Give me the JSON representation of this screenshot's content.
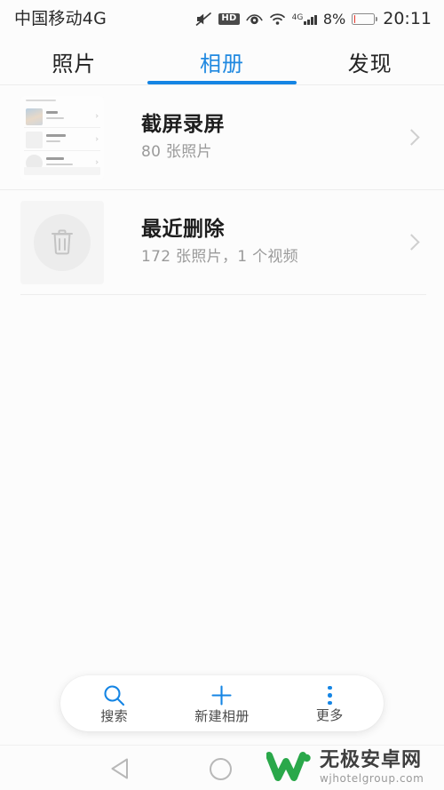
{
  "statusbar": {
    "carrier": "中国移动4G",
    "hd_label": "HD",
    "network_type": "4G",
    "battery_percent": "8%",
    "battery_level": 8,
    "clock": "20:11",
    "icons": [
      "mute-icon",
      "hd-icon",
      "eye-comfort-icon",
      "wifi-icon",
      "signal-bars-icon",
      "battery-icon"
    ],
    "battery_color": "#e8352a"
  },
  "tabs": {
    "items": [
      {
        "label": "照片",
        "active": false
      },
      {
        "label": "相册",
        "active": true
      },
      {
        "label": "发现",
        "active": false
      }
    ],
    "accent_color": "#1585e4"
  },
  "albums": [
    {
      "title": "截屏录屏",
      "subtitle": "80 张照片",
      "thumb_type": "screenshot-preview"
    },
    {
      "title": "最近删除",
      "subtitle": "172 张照片，1 个视频",
      "thumb_type": "trash-icon"
    }
  ],
  "toolbar": {
    "items": [
      {
        "label": "搜索",
        "icon": "search-icon"
      },
      {
        "label": "新建相册",
        "icon": "plus-icon"
      },
      {
        "label": "更多",
        "icon": "more-vertical-icon"
      }
    ],
    "accent_color": "#1585e4"
  },
  "navbar": {
    "back": "back-triangle-icon",
    "home": "home-circle-icon"
  },
  "watermark": {
    "title": "无极安卓网",
    "url": "wjhotelgroup.com",
    "logo_color": "#2aa84a"
  }
}
